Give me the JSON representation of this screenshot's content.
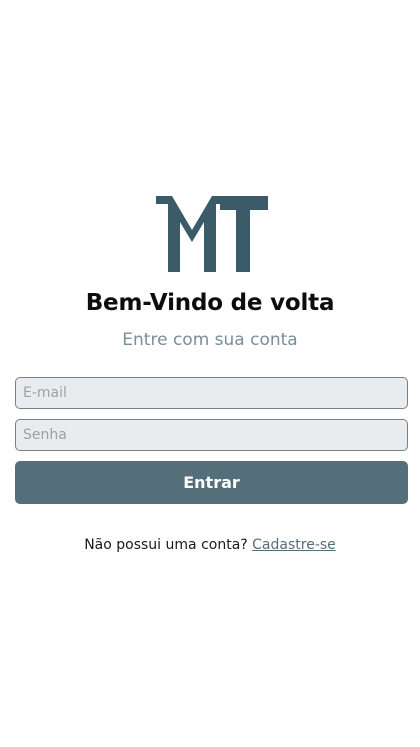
{
  "brand": {
    "logo_text": "MT",
    "logo_color": "#3b5b68"
  },
  "login": {
    "title": "Bem-Vindo de volta",
    "subtitle": "Entre com sua conta",
    "email_placeholder": "E-mail",
    "email_value": "",
    "password_placeholder": "Senha",
    "password_value": "",
    "submit_label": "Entrar",
    "submit_color": "#546e7a"
  },
  "signup": {
    "prompt": "Não possui uma conta?",
    "link_label": "Cadastre-se"
  }
}
